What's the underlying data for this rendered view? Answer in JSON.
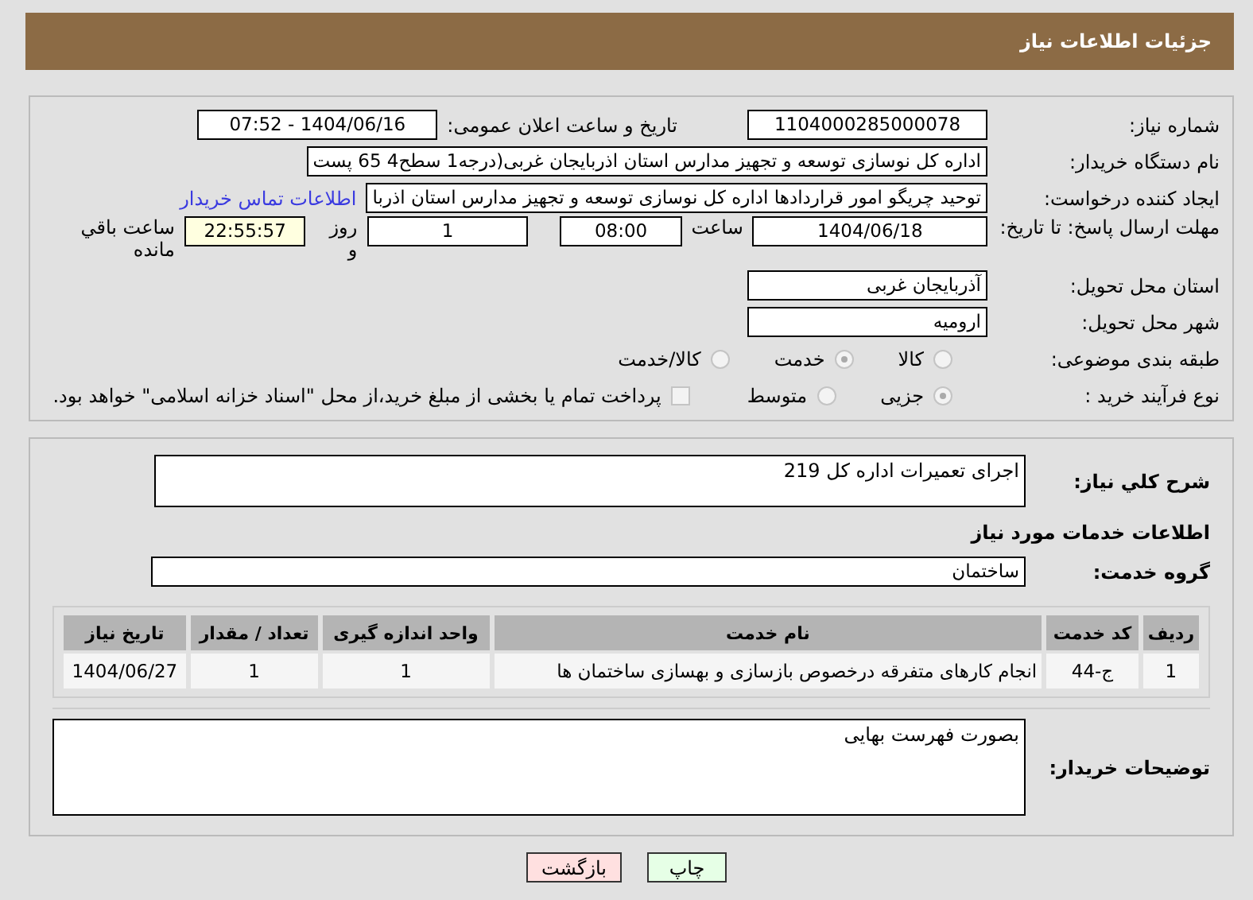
{
  "header": {
    "title": "جزئیات اطلاعات نیاز"
  },
  "need_number": {
    "label": "شماره نیاز:",
    "value": "1104000285000078"
  },
  "announce": {
    "label": "تاریخ و ساعت اعلان عمومی:",
    "value": "1404/06/16 - 07:52"
  },
  "buyer": {
    "label": "نام دستگاه خریدار:",
    "value": "اداره کل نوسازی   توسعه و تجهیز مدارس استان اذربایجان غربی(درجه1  سطح4  65 پست"
  },
  "creator": {
    "label": "ایجاد کننده درخواست:",
    "value": "توحید چریگو امور قراردادها اداره کل نوسازی   توسعه و تجهیز مدارس استان اذربا",
    "link": "اطلاعات تماس خریدار"
  },
  "deadline": {
    "label": "مهلت ارسال پاسخ: تا تاریخ:",
    "date": "1404/06/18",
    "time_label": "ساعت",
    "time": "08:00",
    "days": "1",
    "days_label": "روز و",
    "remaining": "22:55:57",
    "remaining_label": "ساعت باقي مانده"
  },
  "province": {
    "label": "استان محل تحویل:",
    "value": "آذربایجان غربی"
  },
  "city": {
    "label": "شهر محل تحویل:",
    "value": "ارومیه"
  },
  "category": {
    "label": "طبقه بندی موضوعی:",
    "options": [
      {
        "label": "کالا",
        "selected": false
      },
      {
        "label": "خدمت",
        "selected": true
      },
      {
        "label": "کالا/خدمت",
        "selected": false
      }
    ]
  },
  "process": {
    "label": "نوع فرآیند خرید :",
    "options": [
      {
        "label": "جزیی",
        "selected": true
      },
      {
        "label": "متوسط",
        "selected": false
      }
    ],
    "treasury": {
      "checked": false,
      "label": "پرداخت تمام یا بخشی از مبلغ خرید،از محل \"اسناد خزانه اسلامی\" خواهد بود."
    }
  },
  "summary": {
    "label": "شرح کلي نياز:",
    "value": "اجرای تعمیرات اداره کل 219"
  },
  "services_heading": "اطلاعات خدمات مورد نیاز",
  "service_group": {
    "label": "گروه خدمت:",
    "value": "ساختمان"
  },
  "table": {
    "columns": [
      "ردیف",
      "کد خدمت",
      "نام خدمت",
      "واحد اندازه گیری",
      "تعداد / مقدار",
      "تاریخ نیاز"
    ],
    "rows": [
      [
        "1",
        "ج-44",
        "انجام کارهای متفرقه درخصوص بازسازی و بهسازی ساختمان ها",
        "1",
        "1",
        "1404/06/27"
      ]
    ]
  },
  "buyer_notes": {
    "label": "توضیحات خریدار:",
    "value": "بصورت فهرست بهایی"
  },
  "buttons": [
    {
      "label": "چاپ",
      "kind": "print"
    },
    {
      "label": "بازگشت",
      "kind": "back"
    }
  ]
}
